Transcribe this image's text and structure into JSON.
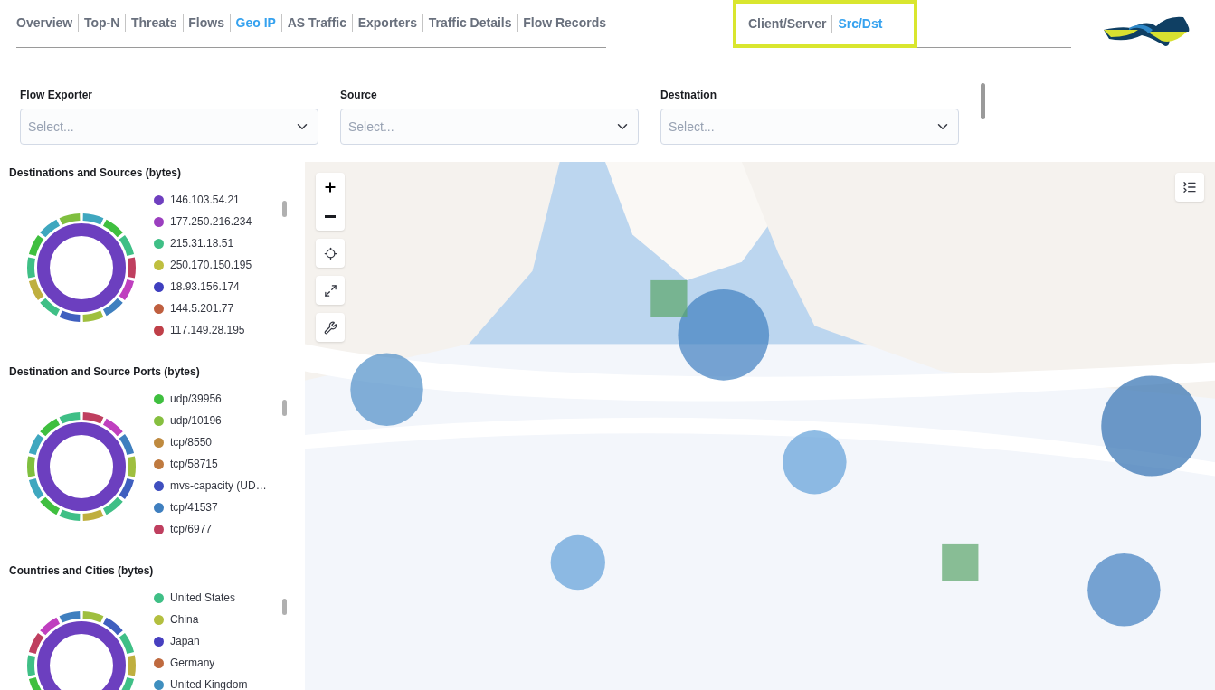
{
  "tabs": [
    {
      "label": "Overview",
      "selected": false
    },
    {
      "label": "Top-N",
      "selected": false
    },
    {
      "label": "Threats",
      "selected": false
    },
    {
      "label": "Flows",
      "selected": false
    },
    {
      "label": "Geo IP",
      "selected": true
    },
    {
      "label": "AS Traffic",
      "selected": false
    },
    {
      "label": "Exporters",
      "selected": false
    },
    {
      "label": "Traffic Details",
      "selected": false
    },
    {
      "label": "Flow Records",
      "selected": false
    }
  ],
  "view_tabs": [
    {
      "label": "Client/Server",
      "selected": false
    },
    {
      "label": "Src/Dst",
      "selected": true
    }
  ],
  "filters": [
    {
      "label": "Flow Exporter",
      "placeholder": "Select..."
    },
    {
      "label": "Source",
      "placeholder": "Select..."
    },
    {
      "label": "Destnation",
      "placeholder": "Select..."
    }
  ],
  "panels": [
    {
      "title": "Destinations and Sources (bytes)",
      "legend": [
        {
          "label": "146.103.54.21",
          "color": "#6f3fbf"
        },
        {
          "label": "177.250.216.234",
          "color": "#9b3fbf"
        },
        {
          "label": "215.31.18.51",
          "color": "#3fbf86"
        },
        {
          "label": "250.170.150.195",
          "color": "#bfbf3f"
        },
        {
          "label": "18.93.156.174",
          "color": "#3f3fbf"
        },
        {
          "label": "144.5.201.77",
          "color": "#bf5f3f"
        },
        {
          "label": "117.149.28.195",
          "color": "#bf3f48"
        }
      ]
    },
    {
      "title": "Destination and Source Ports (bytes)",
      "legend": [
        {
          "label": "udp/39956",
          "color": "#3fbf3f"
        },
        {
          "label": "udp/10196",
          "color": "#86bf3f"
        },
        {
          "label": "tcp/8550",
          "color": "#bf8a3f"
        },
        {
          "label": "tcp/58715",
          "color": "#bf7a3f"
        },
        {
          "label": "mvs-capacity (UD…",
          "color": "#3f4fbf"
        },
        {
          "label": "tcp/41537",
          "color": "#3f7fbf"
        },
        {
          "label": "tcp/6977",
          "color": "#bf3f5f"
        }
      ]
    },
    {
      "title": "Countries and Cities (bytes)",
      "legend": [
        {
          "label": "United States",
          "color": "#3fbf86"
        },
        {
          "label": "China",
          "color": "#b3bf3f"
        },
        {
          "label": "Japan",
          "color": "#473fbf"
        },
        {
          "label": "Germany",
          "color": "#bf6a3f"
        },
        {
          "label": "United Kingdom",
          "color": "#3f8fbf"
        }
      ]
    }
  ]
}
